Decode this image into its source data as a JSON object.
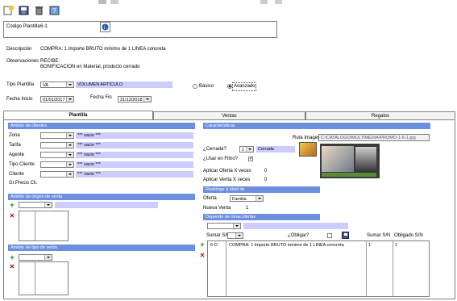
{
  "codigo": {
    "label": "Código Plantilla",
    "value": "6-1"
  },
  "descripcion": {
    "label": "Descripción",
    "value": "COMPRA: 1 Importe BRUTO mínimo de 1 LINEA concreta"
  },
  "observaciones": {
    "label": "Observaciones",
    "line1": "RECIBE:",
    "line2": "BONIFICACION en Material, producto cerrado"
  },
  "tipo_plantilla": {
    "label": "Tipo Plantilla",
    "value": "VA",
    "desc": "VOLUMEN ARTICULO"
  },
  "modo": {
    "basico": "Básico",
    "avanzado": "Avanzado"
  },
  "fecha_inicio": {
    "label": "Fecha Inicio",
    "value": "01/01/2017"
  },
  "fecha_fin": {
    "label": "Fecha Fin",
    "value": "31/12/2018"
  },
  "tabs": [
    "Plantilla",
    "Ventas",
    "Regalos"
  ],
  "ambito_clientes": {
    "header": "Ambito de clientes",
    "rows": [
      {
        "label": "Zona",
        "value": "*** vacio ***"
      },
      {
        "label": "Tarifa",
        "value": "*** vacio ***"
      },
      {
        "label": "Agente",
        "value": "*** vacio ***"
      },
      {
        "label": "Tipo Cliente",
        "value": "*** vacio ***"
      },
      {
        "label": "Cliente",
        "value": "*** vacio ***"
      }
    ],
    "gr_precio": "Gr.Precio Cli."
  },
  "ambito_origen": {
    "header": "Ambito de origen de venta"
  },
  "ambito_tipo": {
    "header": "Ambito de tipo de venta"
  },
  "caracteristicas": {
    "header": "Características",
    "ruta_label": "Ruta Imagen",
    "ruta_value": "C:\\CATALOGO\\MULTIMEDIA\\PROMO-1-6-1.jpg",
    "cerrada_label": "¿Cerrada?",
    "cerrada_value": "1",
    "cerrada_text": "Cerrada",
    "filtro_label": "¿Usar en Filtro?",
    "aplicar_oferta_label": "Aplicar Oferta X veces",
    "aplicar_oferta_value": "0",
    "aplicar_venta_label": "Aplicar Venta X veces",
    "aplicar_venta_value": "0"
  },
  "restringe": {
    "header": "Restringe a nivel de",
    "oferta_label": "Oferta",
    "oferta_value": "Familia",
    "nueva_label": "Nueva Venta",
    "nueva_value": "1"
  },
  "depende": {
    "header": "Depende de otras ofertas",
    "sumar_label": "Sumar S/N",
    "obligar_label": "¿Obligar?",
    "col_sumar": "Sumar S/N",
    "col_obligado": "Obligado S/N",
    "rows": [
      {
        "code": "6-D",
        "desc": "COMPRA: 1 Importe BRUTO mínimo de 1 LINEA concreta",
        "sumar": "1",
        "obligado": "1"
      }
    ]
  }
}
